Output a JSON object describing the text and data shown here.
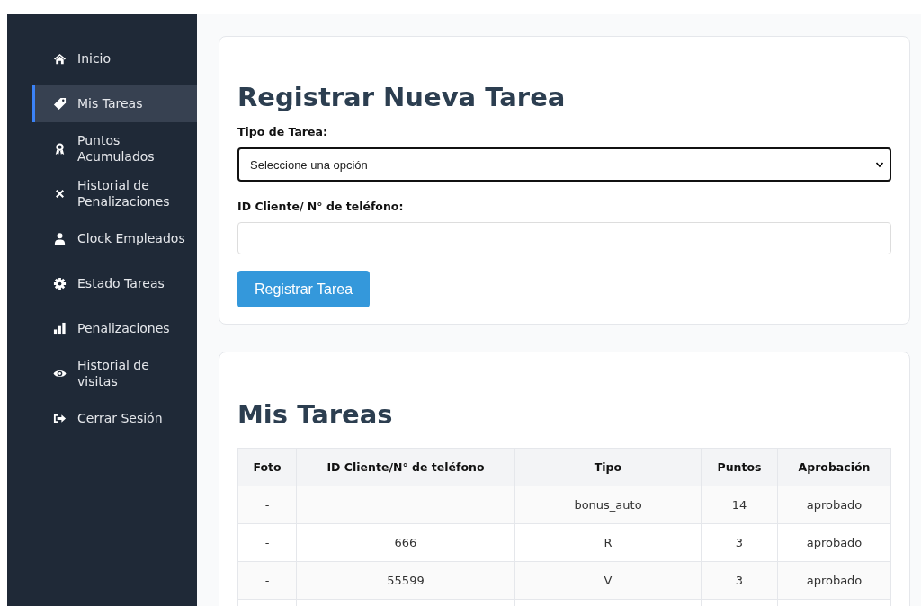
{
  "sidebar": {
    "items": [
      {
        "label": "Inicio",
        "selected": false
      },
      {
        "label": "Mis Tareas",
        "selected": true
      },
      {
        "label": "Puntos Acumulados",
        "selected": false
      },
      {
        "label": "Historial de Penalizaciones",
        "selected": false
      },
      {
        "label": "Clock Empleados",
        "selected": false
      },
      {
        "label": "Estado Tareas",
        "selected": false
      },
      {
        "label": "Penalizaciones",
        "selected": false
      },
      {
        "label": "Historial de visitas",
        "selected": false
      },
      {
        "label": "Cerrar Sesión",
        "selected": false
      }
    ]
  },
  "form": {
    "title": "Registrar Nueva Tarea",
    "type_label": "Tipo de Tarea:",
    "type_value": "Seleccione una opción",
    "id_label": "ID Cliente/ N° de teléfono:",
    "submit": "Registrar Tarea"
  },
  "tasks": {
    "title": "Mis Tareas",
    "columns": [
      "Foto",
      "ID Cliente/N° de teléfono",
      "Tipo",
      "Puntos",
      "Aprobación"
    ],
    "rows": [
      [
        "-",
        "",
        "bonus_auto",
        "14",
        "aprobado"
      ],
      [
        "-",
        "666",
        "R",
        "3",
        "aprobado"
      ],
      [
        "-",
        "55599",
        "V",
        "3",
        "aprobado"
      ]
    ]
  }
}
